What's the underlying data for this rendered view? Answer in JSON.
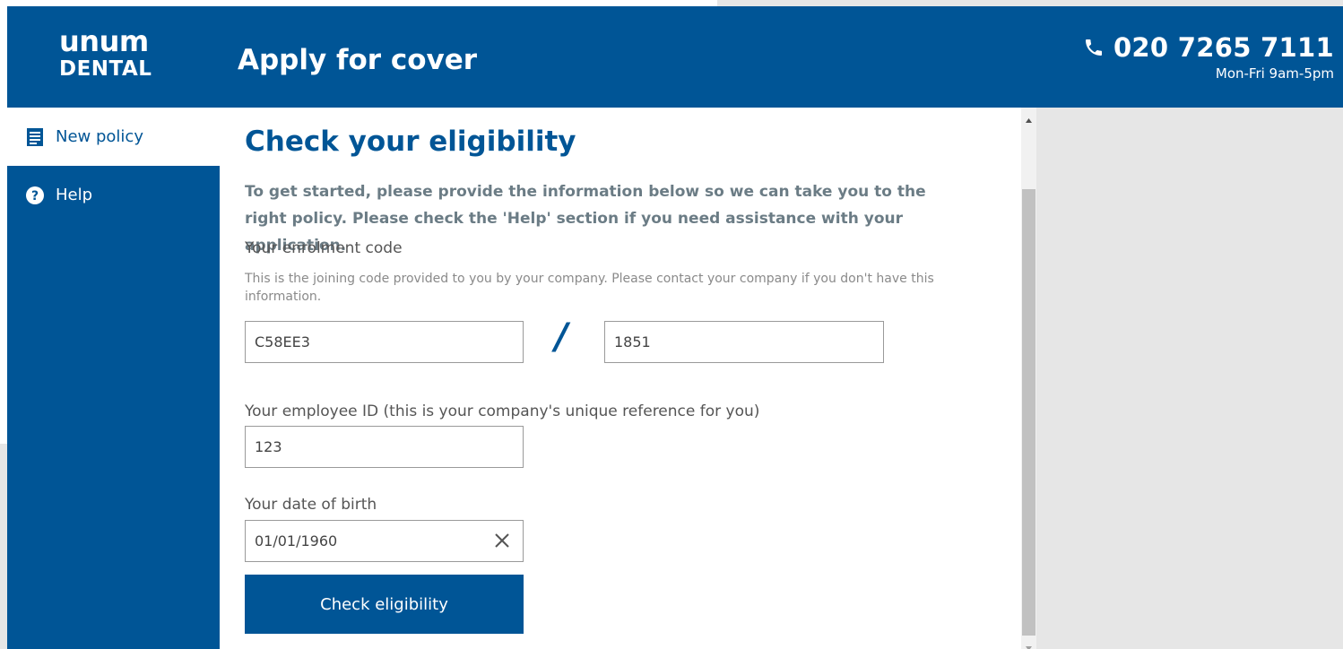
{
  "header": {
    "logo_top": "unum",
    "logo_bottom": "DENTAL",
    "title": "Apply for cover",
    "phone": "020 7265 7111",
    "hours": "Mon-Fri 9am-5pm"
  },
  "sidebar": {
    "items": [
      {
        "label": "New policy",
        "icon": "document-icon",
        "active": true
      },
      {
        "label": "Help",
        "icon": "help-icon",
        "active": false
      }
    ]
  },
  "main": {
    "title": "Check your eligibility",
    "intro": "To get started, please provide the information below so we can take you to the right policy. Please check the 'Help' section if you need assistance with your application.",
    "enrolment": {
      "label": "Your enrolment code",
      "hint": "This is the joining code provided to you by your company. Please contact your company if you don't have this information.",
      "part1": "C58EE3",
      "separator": "/",
      "part2": "1851"
    },
    "employee": {
      "label": "Your employee ID (this is your company's unique reference for you)",
      "value": "123"
    },
    "dob": {
      "label": "Your date of birth",
      "value": "01/01/1960"
    },
    "submit_label": "Check eligibility"
  },
  "colors": {
    "brand": "#005596",
    "page_background": "#e6e6e6",
    "intro_text": "#6b7c85"
  }
}
